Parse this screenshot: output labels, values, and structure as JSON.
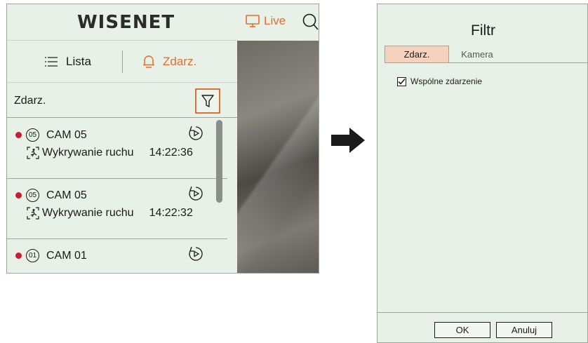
{
  "left": {
    "logo": "WISENET",
    "live_label": "Live",
    "tabs": {
      "list_label": "Lista",
      "event_label": "Zdarz."
    },
    "section_title": "Zdarz.",
    "events": [
      {
        "cam_num": "05",
        "cam_name": "CAM 05",
        "type": "Wykrywanie ruchu",
        "time": "14:22:36"
      },
      {
        "cam_num": "05",
        "cam_name": "CAM 05",
        "type": "Wykrywanie ruchu",
        "time": "14:22:32"
      },
      {
        "cam_num": "01",
        "cam_name": "CAM 01"
      }
    ]
  },
  "dialog": {
    "title": "Filtr",
    "tabs": [
      "Zdarz.",
      "Kamera"
    ],
    "checkbox_label": "Wspólne zdarzenie",
    "checkbox_checked": true,
    "ok_label": "OK",
    "cancel_label": "Anuluj"
  },
  "colors": {
    "accent": "#e07030",
    "panel_bg": "#e8f1e8",
    "rec": "#c81e32",
    "tab_active": "#f5d2bd"
  },
  "icons": [
    "monitor-icon",
    "search-icon",
    "list-icon",
    "bell-icon",
    "filter-icon",
    "play-icon",
    "motion-icon",
    "checkbox-check-icon",
    "arrow-right-icon"
  ]
}
